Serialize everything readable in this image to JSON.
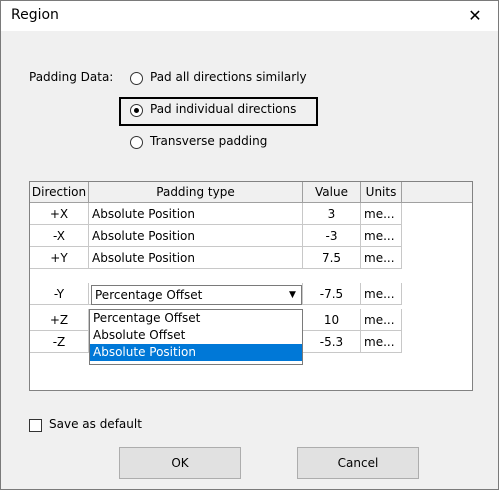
{
  "window": {
    "title": "Region",
    "close_glyph": "✕"
  },
  "padding": {
    "label": "Padding Data:",
    "options": [
      {
        "label": "Pad all directions similarly",
        "checked": false
      },
      {
        "label": "Pad individual directions",
        "checked": true
      },
      {
        "label": "Transverse padding",
        "checked": false
      }
    ]
  },
  "table": {
    "headers": [
      "Direction",
      "Padding type",
      "Value",
      "Units"
    ],
    "rows": [
      {
        "direction": "+X",
        "type": "Absolute Position",
        "value": "3",
        "units": "me..."
      },
      {
        "direction": "-X",
        "type": "Absolute Position",
        "value": "-3",
        "units": "me..."
      },
      {
        "direction": "+Y",
        "type": "Absolute Position",
        "value": "7.5",
        "units": "me..."
      },
      {
        "direction": "-Y",
        "type": "Percentage Offset",
        "value": "-7.5",
        "units": "me..."
      },
      {
        "direction": "+Z",
        "type": "",
        "value": "10",
        "units": "me..."
      },
      {
        "direction": "-Z",
        "type": "",
        "value": "-5.3",
        "units": "me..."
      }
    ],
    "dropdown_options": [
      "Percentage Offset",
      "Absolute Offset",
      "Absolute Position"
    ],
    "dropdown_selected": "Absolute Position"
  },
  "save_default": {
    "label": "Save as default",
    "checked": false
  },
  "buttons": {
    "ok": "OK",
    "cancel": "Cancel"
  },
  "icons": {
    "close": "close-icon",
    "combo_arrow": "chevron-down-icon"
  },
  "colors": {
    "selection": "#0078d7",
    "dialog_bg": "#f0f0f0"
  }
}
